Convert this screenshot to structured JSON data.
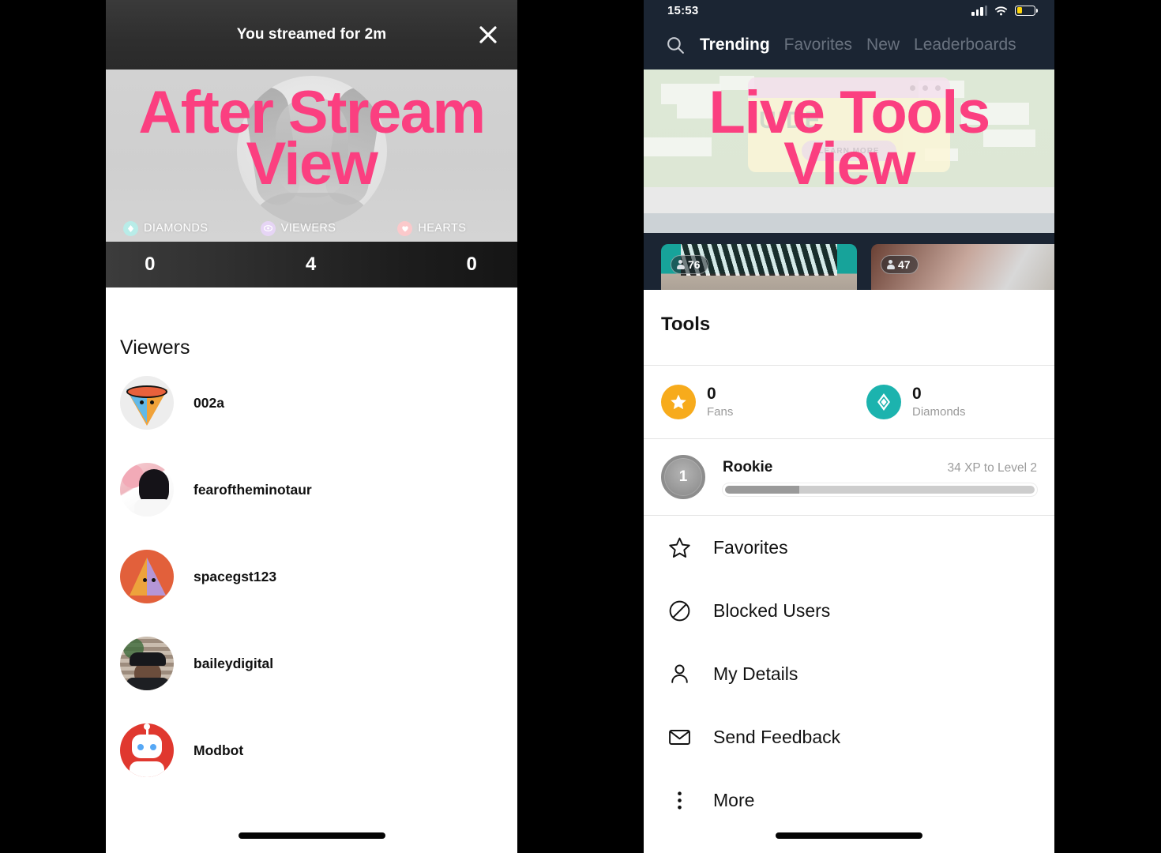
{
  "annotations": {
    "left": {
      "line1": "After Stream",
      "line2": "View",
      "color": "#fb3f80"
    },
    "right": {
      "line1": "Live Tools",
      "line2": "View",
      "color": "#fb3f80"
    }
  },
  "after_stream": {
    "header": {
      "title": "You streamed for 2m",
      "close_icon": "close-icon"
    },
    "stats": [
      {
        "label": "DIAMONDS",
        "value": "0",
        "icon": "diamond-icon",
        "color": "#b8ece8"
      },
      {
        "label": "VIEWERS",
        "value": "4",
        "icon": "eye-icon",
        "color": "#e6d5f5"
      },
      {
        "label": "HEARTS",
        "value": "0",
        "icon": "heart-icon",
        "color": "#fbc9cb"
      }
    ],
    "section_title": "Viewers",
    "viewers": [
      {
        "name": "002a",
        "avatar": "cone-avatar"
      },
      {
        "name": "fearoftheminotaur",
        "avatar": "photo-avatar-pink"
      },
      {
        "name": "spacegst123",
        "avatar": "pyramid-avatar"
      },
      {
        "name": "baileydigital",
        "avatar": "photo-avatar-cap"
      },
      {
        "name": "Modbot",
        "avatar": "robot-avatar"
      }
    ]
  },
  "live_tools": {
    "status_bar": {
      "time": "15:53",
      "icons": [
        "cellular-icon",
        "wifi-icon",
        "battery-icon"
      ]
    },
    "nav": {
      "search_icon": "search-icon",
      "tabs": [
        {
          "label": "Trending",
          "active": true
        },
        {
          "label": "Favorites",
          "active": false
        },
        {
          "label": "New",
          "active": false
        },
        {
          "label": "Leaderboards",
          "active": false
        }
      ]
    },
    "banner": {
      "headline": "UIDE",
      "cta": "LEARN MORE"
    },
    "thumbnails": [
      {
        "viewers": "76"
      },
      {
        "viewers": "47"
      }
    ],
    "sheet": {
      "title": "Tools",
      "stats": [
        {
          "value": "0",
          "label": "Fans",
          "icon": "star-icon",
          "color": "#f7ab1c"
        },
        {
          "value": "0",
          "label": "Diamonds",
          "icon": "diamond-icon",
          "color": "#1cb3ae"
        }
      ],
      "level": {
        "number": "1",
        "name": "Rookie",
        "xp_text": "34 XP to Level 2",
        "progress_percent": 24
      },
      "menu": [
        {
          "label": "Favorites",
          "icon": "star-outline-icon"
        },
        {
          "label": "Blocked Users",
          "icon": "block-icon"
        },
        {
          "label": "My Details",
          "icon": "person-icon"
        },
        {
          "label": "Send Feedback",
          "icon": "envelope-icon"
        },
        {
          "label": "More",
          "icon": "more-vertical-icon"
        }
      ]
    }
  }
}
